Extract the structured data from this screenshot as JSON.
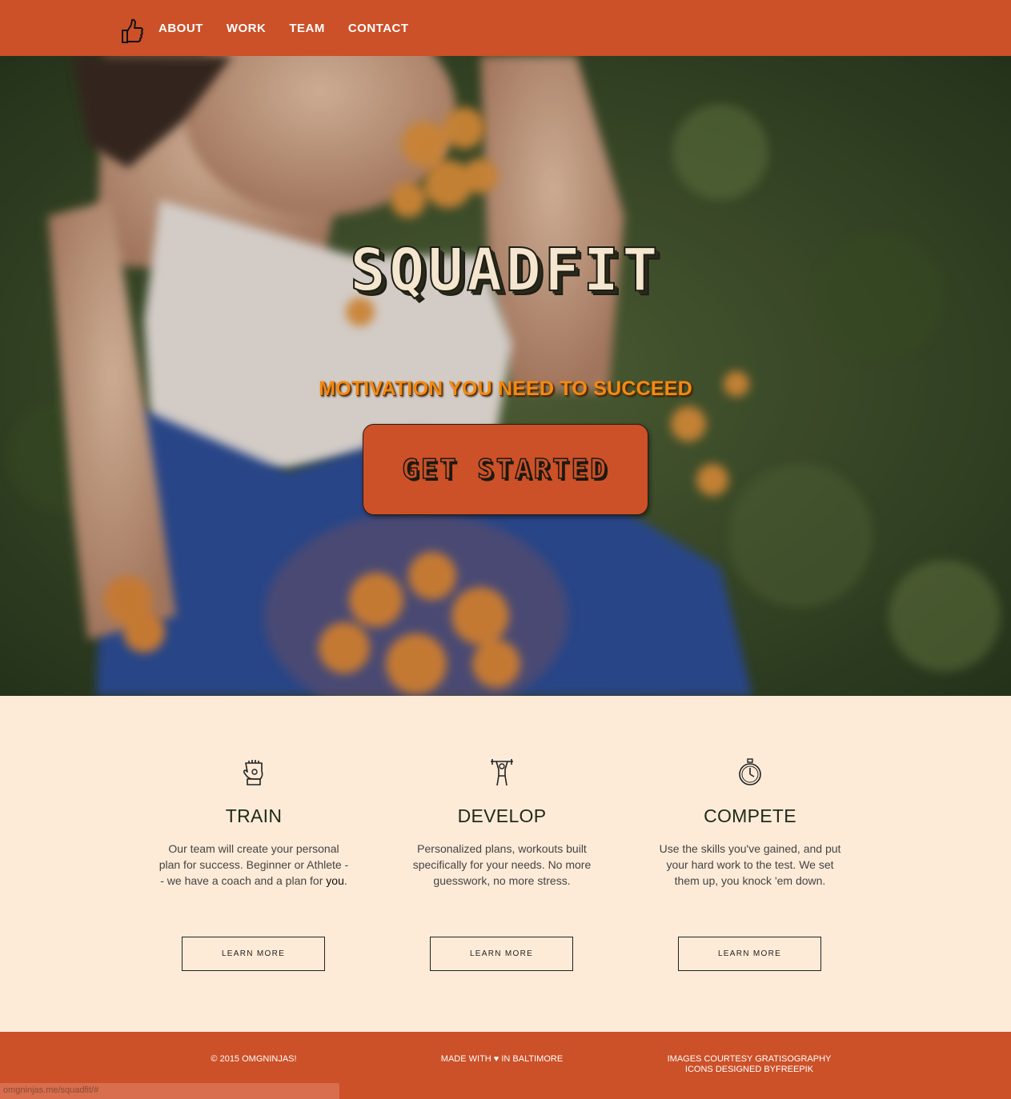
{
  "nav": {
    "logo_icon": "thumbs-up-icon",
    "links": [
      "ABOUT",
      "WORK",
      "TEAM",
      "CONTACT"
    ]
  },
  "hero": {
    "title": "SQUADFIT",
    "tagline": "MOTIVATION YOU NEED TO SUCCEED",
    "cta": "GET STARTED"
  },
  "features": [
    {
      "icon": "glove-icon",
      "title": "TRAIN",
      "text_before": "Our team will create your personal plan for success. Beginner or Athlete -- we have a coach and a plan for ",
      "text_emphasis": "you",
      "text_after": ".",
      "button": "LEARN MORE"
    },
    {
      "icon": "weightlifter-icon",
      "title": "DEVELOP",
      "text_before": "Personalized plans, workouts built specifically for your needs. No more guesswork, no more stress.",
      "text_emphasis": "",
      "text_after": "",
      "button": "LEARN MORE"
    },
    {
      "icon": "stopwatch-icon",
      "title": "COMPETE",
      "text_before": "Use the skills you've gained, and put your hard work to the test. We set them up, you knock 'em down.",
      "text_emphasis": "",
      "text_after": "",
      "button": "LEARN MORE"
    }
  ],
  "footer": {
    "copyright": "© 2015 OMGNINJAS!",
    "made_with": "MADE WITH ♥ IN BALTIMORE",
    "credits_line1": "IMAGES COURTESY GRATISOGRAPHY",
    "credits_line2": "ICONS DESIGNED BYFREEPIK"
  },
  "status_bar": "omgninjas.me/squadfit/#",
  "colors": {
    "brand": "#cc5028",
    "background": "#fdebd8",
    "tagline": "#f48a10"
  }
}
